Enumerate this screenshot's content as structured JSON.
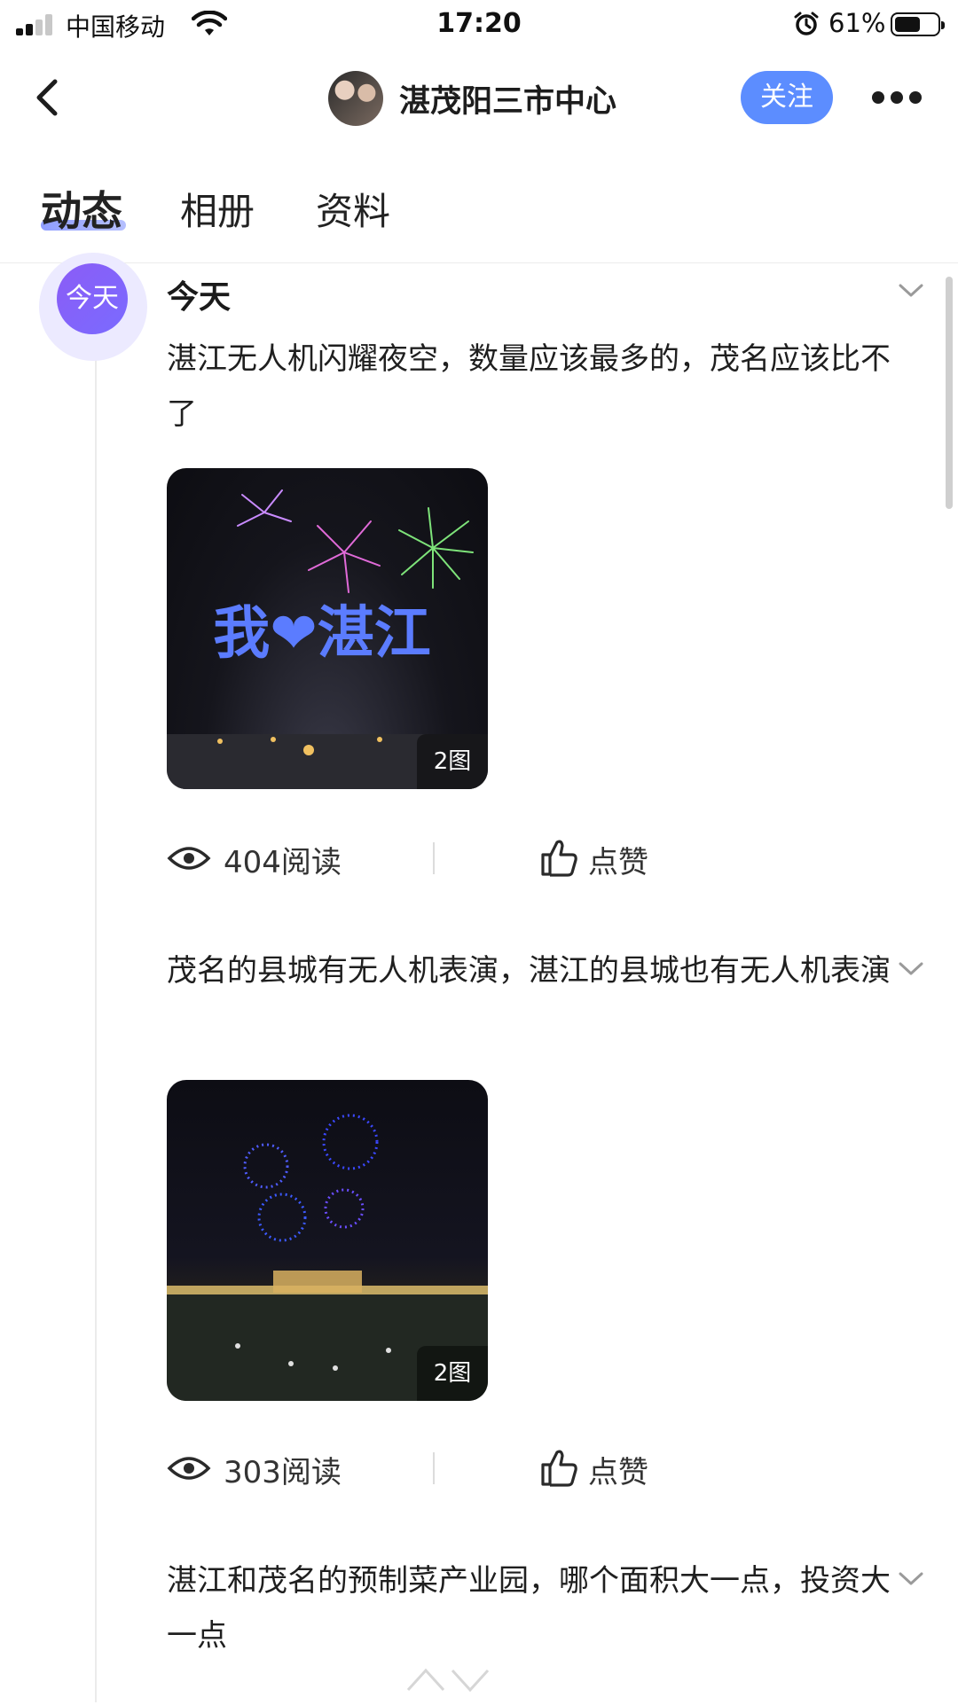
{
  "status_bar": {
    "carrier": "中国移动",
    "time": "17:20",
    "battery_percent_label": "61%",
    "battery_level": 0.61
  },
  "header": {
    "title": "湛茂阳三市中心",
    "follow_label": "关注"
  },
  "tabs": [
    {
      "label": "动态",
      "active": true
    },
    {
      "label": "相册",
      "active": false
    },
    {
      "label": "资料",
      "active": false
    }
  ],
  "timeline": {
    "badge": "今天",
    "date_label": "今天"
  },
  "posts": [
    {
      "text": "湛江无人机闪耀夜空，数量应该最多的，茂名应该比不了",
      "image_count": "2图",
      "image_caption": "我❤湛江",
      "reads": "404阅读",
      "like_label": "点赞"
    },
    {
      "text": "茂名的县城有无人机表演，湛江的县城也有无人机表演",
      "image_count": "2图",
      "reads": "303阅读",
      "like_label": "点赞"
    },
    {
      "text": "湛江和茂名的预制菜产业园，哪个面积大一点，投资大一点"
    }
  ],
  "colors": {
    "accent": "#5c8dff",
    "badge": "#7a6bff"
  }
}
